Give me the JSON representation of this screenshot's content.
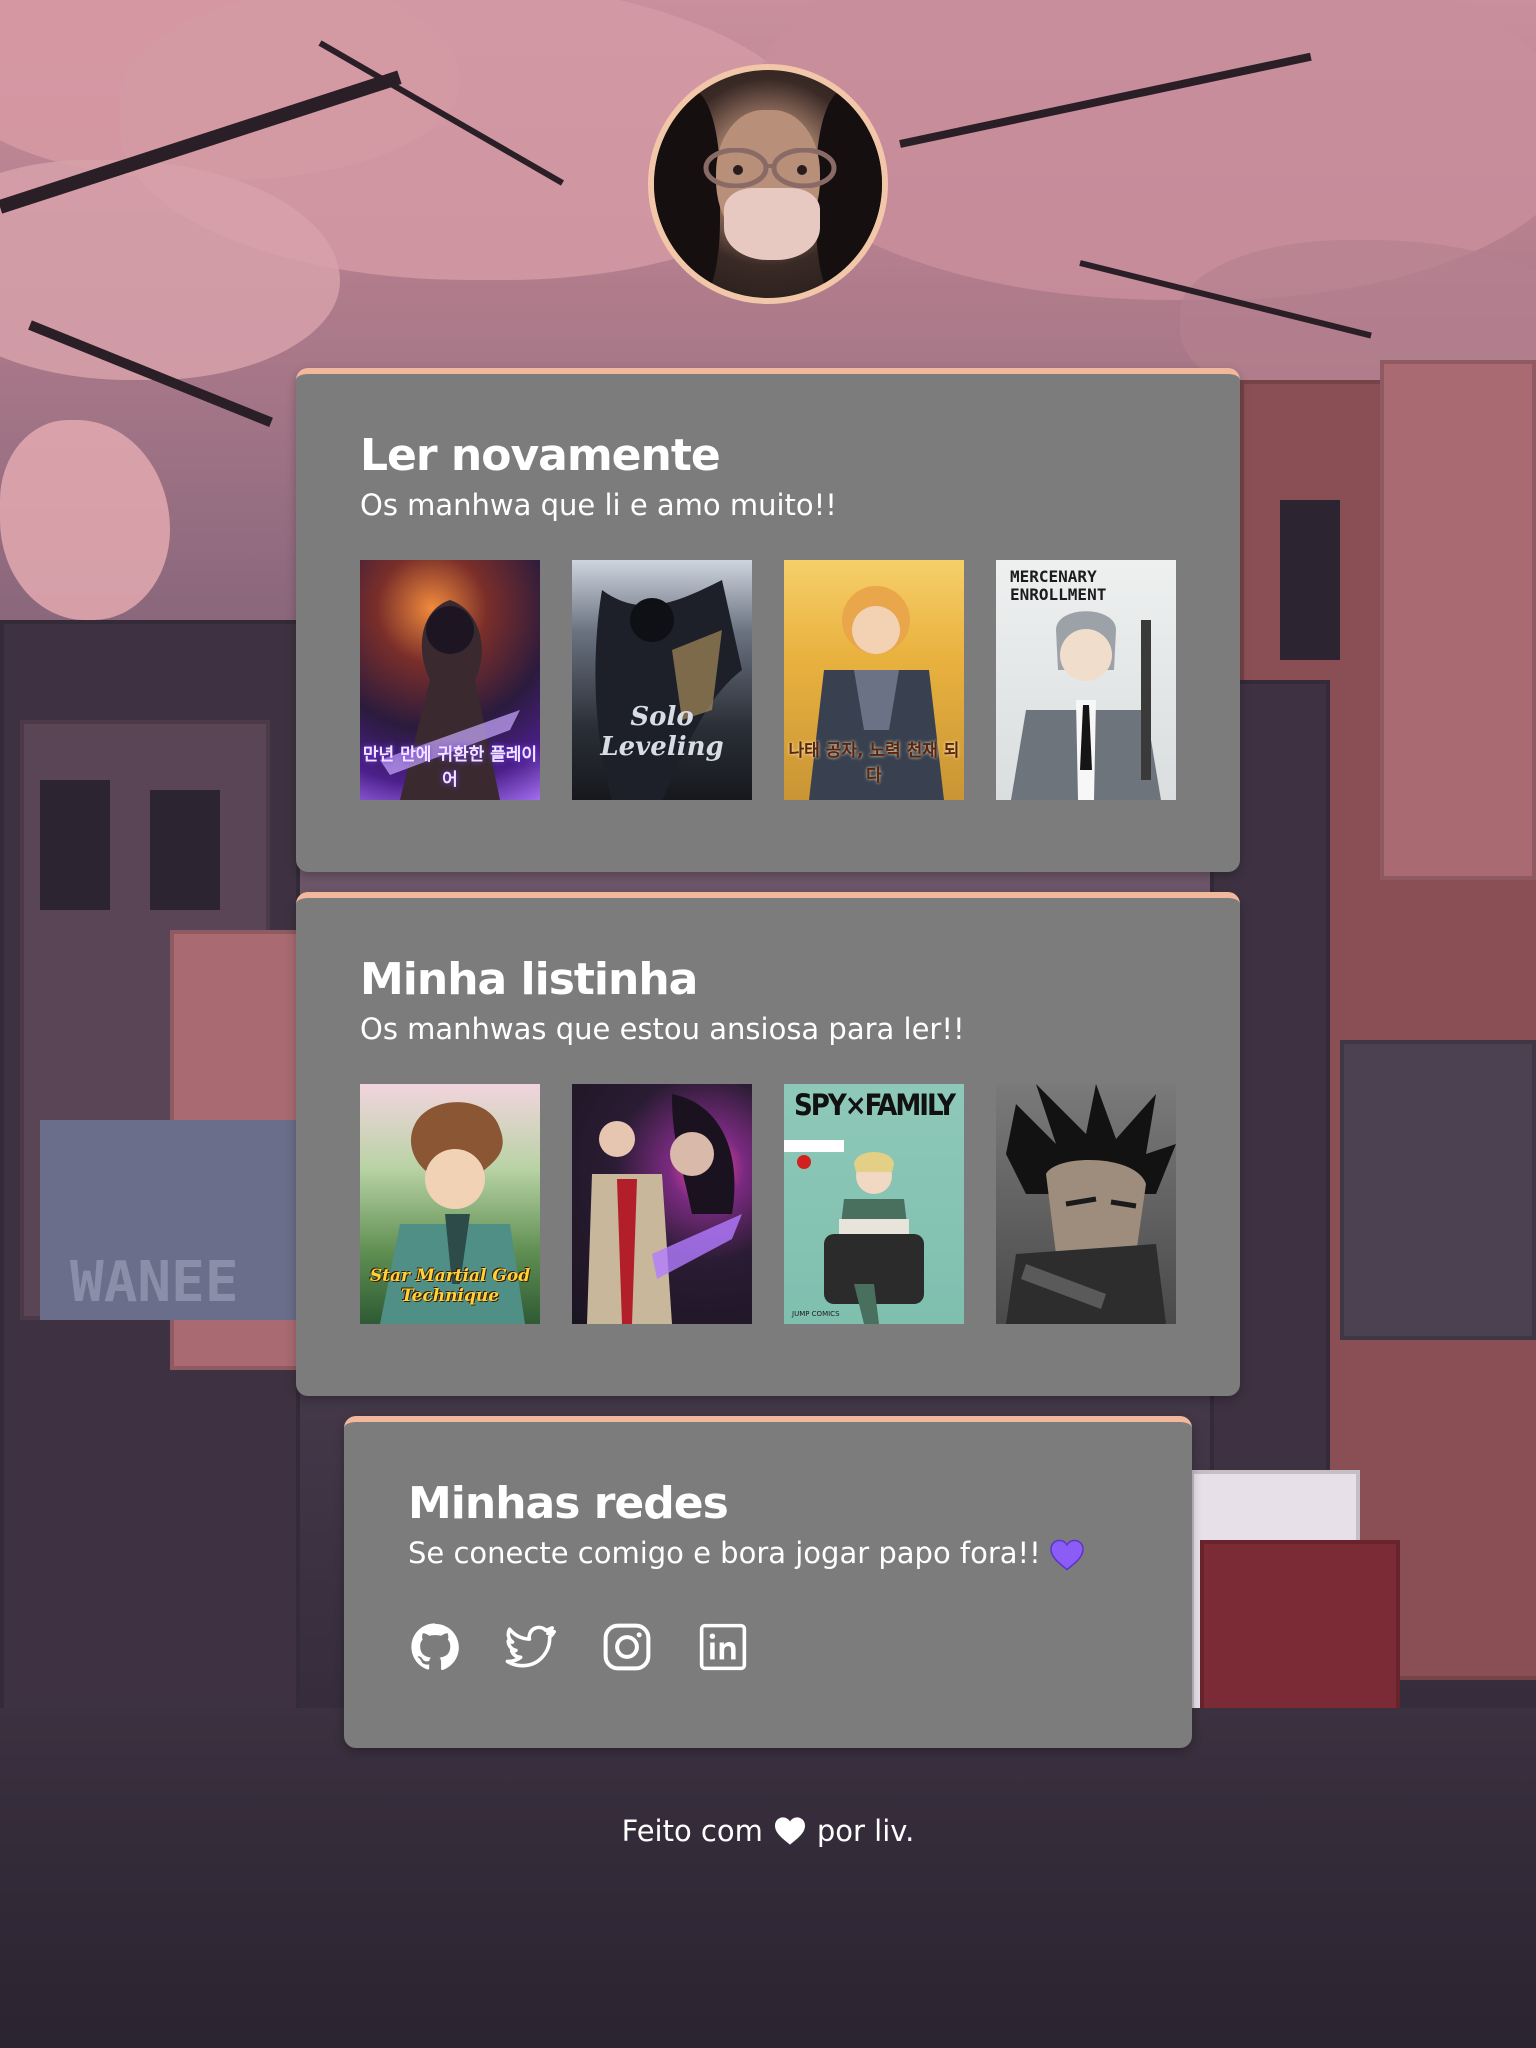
{
  "sections": [
    {
      "title": "Ler novamente",
      "subtitle": "Os manhwa que li e amo muito!!",
      "covers": [
        {
          "alt": "Player Who Returned 10,000 Years Later",
          "caption": "만년 만에 귀환한 플레이어"
        },
        {
          "alt": "Solo Leveling",
          "caption": "Solo Leveling"
        },
        {
          "alt": "Crown Prince cover",
          "caption": "나태 공자, 노력 천재 되다"
        },
        {
          "alt": "Mercenary Enrollment",
          "caption": "MERCENARY ENROLLMENT"
        }
      ]
    },
    {
      "title": "Minha listinha",
      "subtitle": "Os manhwas que estou ansiosa para ler!!",
      "covers": [
        {
          "alt": "Star Martial God Technique",
          "caption": "Star Martial God Technique"
        },
        {
          "alt": "Manhwa cover",
          "caption": ""
        },
        {
          "alt": "Spy x Family",
          "caption": "SPY×FAMILY"
        },
        {
          "alt": "Berserk",
          "caption": ""
        }
      ]
    }
  ],
  "social_section": {
    "title": "Minhas redes",
    "subtitle": "Se conecte comigo e bora jogar papo fora!!",
    "links": [
      {
        "icon": "github-icon"
      },
      {
        "icon": "twitter-icon"
      },
      {
        "icon": "instagram-icon"
      },
      {
        "icon": "linkedin-icon"
      }
    ]
  },
  "footer": {
    "prefix": "Feito com",
    "suffix": "por liv."
  },
  "colors": {
    "card_bg": "#7c7c7c",
    "card_accent": "#f1b89c",
    "heart_purple": "#8b5cf6",
    "text": "#ffffff"
  }
}
